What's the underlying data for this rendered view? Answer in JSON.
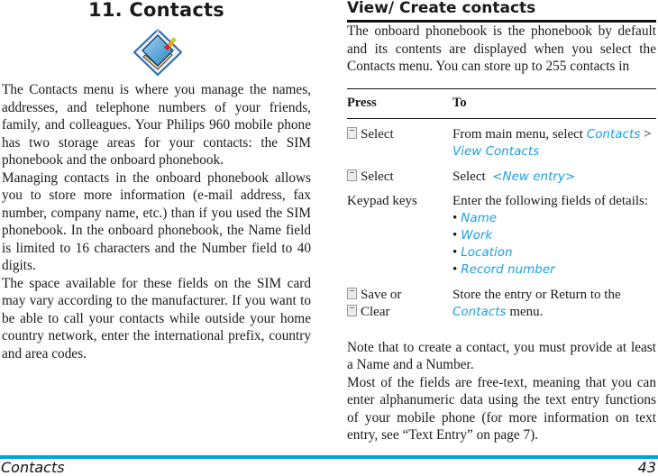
{
  "chapter": {
    "title": "11. Contacts",
    "icon": "address-book-icon"
  },
  "left_column": {
    "paragraphs": [
      "The Contacts menu is where you manage the names, addresses, and telephone numbers of your friends, family, and colleagues. Your Philips 960 mobile phone has two storage areas for your contacts: the SIM phonebook and the onboard phonebook.",
      "Managing contacts in the onboard phonebook allows you to store more information (e-mail address, fax number, company name, etc.) than if you used the SIM phonebook. In the onboard phonebook, the Name field is limited to 16 characters and the Number field to 40 digits.",
      "The space available for these fields on the SIM card may vary according to the manufacturer. If you want to be able to call your contacts while outside your home country network, enter the international prefix, country and area codes."
    ]
  },
  "right_column": {
    "section_title": "View/ Create contacts",
    "intro": "The onboard phonebook is the phonebook by default and its contents are displayed when you select the Contacts menu. You can store up to 255 contacts in",
    "table": {
      "headers": [
        "Press",
        "To"
      ],
      "rows": [
        {
          "press": "Select",
          "press_icon": "softkey-icon",
          "to_text": "From main menu, select ",
          "to_link1": "Contacts",
          "to_sep": " > ",
          "to_link2": "View Contacts"
        },
        {
          "press": "Select",
          "press_icon": "softkey-icon",
          "to_text": "Select ",
          "to_link1": "<New entry>"
        },
        {
          "press": "Keypad keys",
          "to_text": "Enter the following fields of details:",
          "fields": [
            "Name",
            "Work",
            "Location",
            "Record number"
          ]
        },
        {
          "press_line1": "Save or",
          "press_line2": "Clear",
          "press_icon": "softkey-icon",
          "to_text": "Store the entry or Return to the ",
          "to_link1": "Contacts",
          "to_tail": " menu."
        }
      ]
    },
    "notes": [
      "Note that to create a contact, you must provide at least a Name and a Number.",
      "Most of the fields are free-text, meaning that you can enter alphanumeric data using the text entry functions of your mobile phone (for more information on text entry, see “Text Entry” on page 7)."
    ]
  },
  "footer": {
    "section_name": "Contacts",
    "page_number": "43"
  },
  "colors": {
    "accent_blue": "#00a0e3",
    "link_blue": "#1aa0e6",
    "text": "#1a1a1a"
  }
}
